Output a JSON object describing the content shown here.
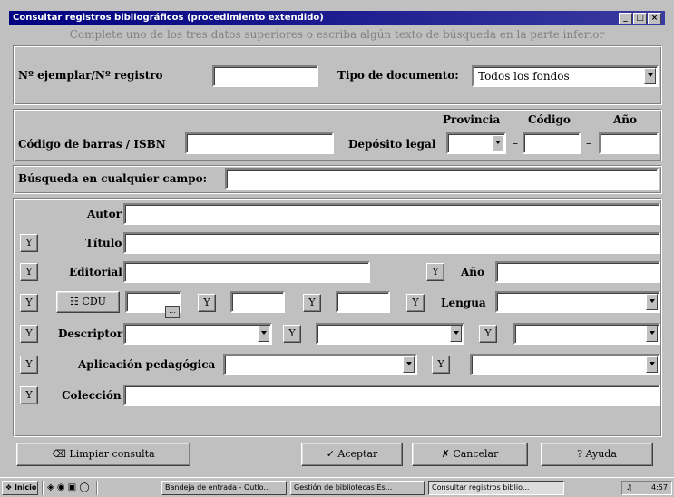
{
  "window": {
    "title": "Consultar registros bibliográficos (procedimiento extendido)",
    "hint": "Complete uno de los tres datos superiores o escriba algún texto de búsqueda en la parte inferior",
    "controls": [
      "_",
      "□",
      "×"
    ]
  },
  "top": {
    "ejemplar_label": "Nº ejemplar/Nº registro",
    "ejemplar_value": "",
    "tipo_label": "Tipo de documento:",
    "tipo_value": "Todos los fondos"
  },
  "middle": {
    "barras_label": "Código de barras / ISBN",
    "barras_value": "",
    "deposito_label": "Depósito legal",
    "provincia_header": "Provincia",
    "codigo_header": "Código",
    "anio_header": "Año",
    "dash": "–"
  },
  "busqueda": {
    "label": "Búsqueda en cualquier campo:",
    "value": ""
  },
  "fields": {
    "y": "Y",
    "autor": "Autor",
    "titulo": "Título",
    "editorial": "Editorial",
    "anio": "Año",
    "cdu": "CDU",
    "lengua": "Lengua",
    "descriptor": "Descriptor",
    "aplicacion": "Aplicación pedagógica",
    "coleccion": "Colección"
  },
  "buttons": {
    "limpiar": "Limpiar consulta",
    "aceptar": "Aceptar",
    "cancelar": "Cancelar",
    "ayuda": "Ayuda"
  },
  "taskbar": {
    "start": "Inicio",
    "items": [
      "Bandeja de entrada - Outlo...",
      "Gestión de bibliotecas Es...",
      "Consultar registros biblio..."
    ],
    "clock": "4:57"
  }
}
